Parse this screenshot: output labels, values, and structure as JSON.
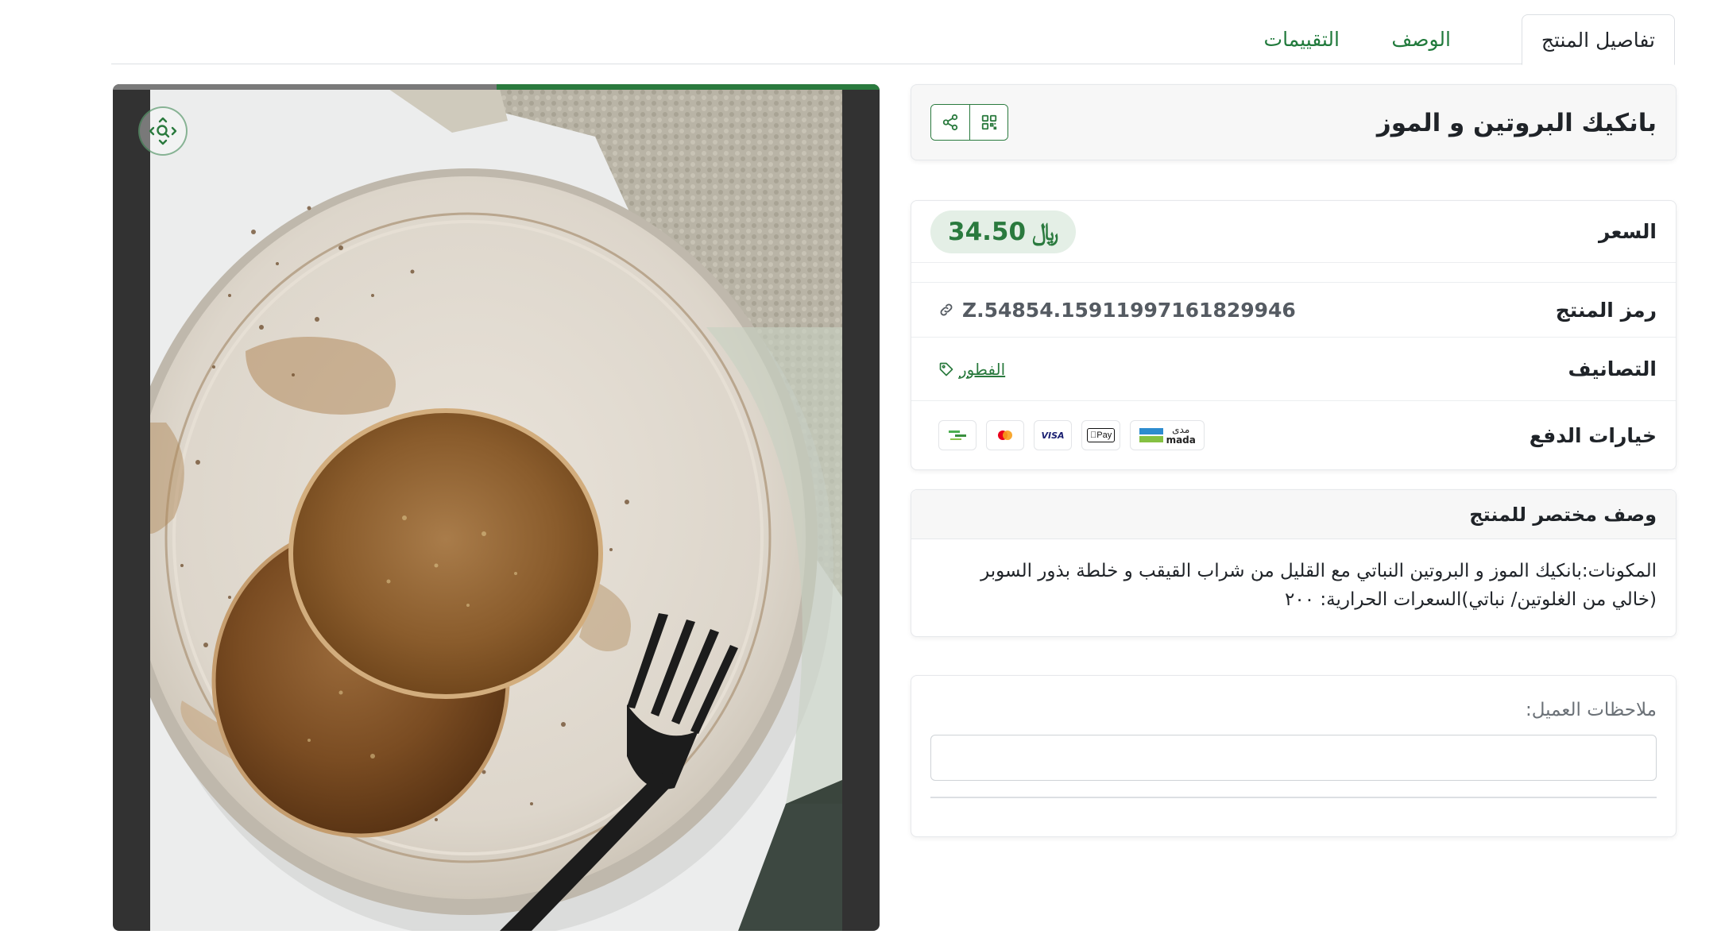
{
  "tabs": [
    {
      "label": "تفاصيل المنتج",
      "active": true
    },
    {
      "label": "الوصف",
      "active": false
    },
    {
      "label": "التقييمات",
      "active": false
    }
  ],
  "image_viewer": {
    "slide_progress": 0.5,
    "zoom_icon": "zoom-move-icon",
    "image_alt": "بانكيك البروتين و الموز"
  },
  "product": {
    "title": "بانكيك البروتين و الموز",
    "actions": [
      {
        "icon": "qr-code-icon"
      },
      {
        "icon": "share-icon"
      }
    ]
  },
  "details": {
    "price_label": "السعر",
    "price_value": "34.50",
    "currency_symbol": "﷼",
    "sku_label": "رمز المنتج",
    "sku_value": "Z.54854.15911997161829946",
    "categories_label": "التصانيف",
    "category": "الفطور",
    "payment_label": "خيارات الدفع",
    "payment_methods": [
      {
        "name": "mada",
        "text_ar": "مدى",
        "text_en": "mada"
      },
      {
        "name": "apple-pay",
        "text": "Pay"
      },
      {
        "name": "visa",
        "text": "VISA"
      },
      {
        "name": "mastercard"
      },
      {
        "name": "bank-transfer"
      }
    ]
  },
  "short_description": {
    "heading": "وصف مختصر للمنتج",
    "body": "المكونات:بانكيك الموز و البروتين النباتي مع القليل من شراب القيقب و خلطة بذور السوبر (خالي من الغلوتين/ نباتي)السعرات الحرارية: ٢٠٠"
  },
  "customer_notes": {
    "label": "ملاحظات العميل:",
    "value": "",
    "placeholder": ""
  },
  "colors": {
    "brand_green": "#2a7a3e",
    "price_pill_bg": "#e4efe6",
    "image_frame_bg": "#323232"
  }
}
